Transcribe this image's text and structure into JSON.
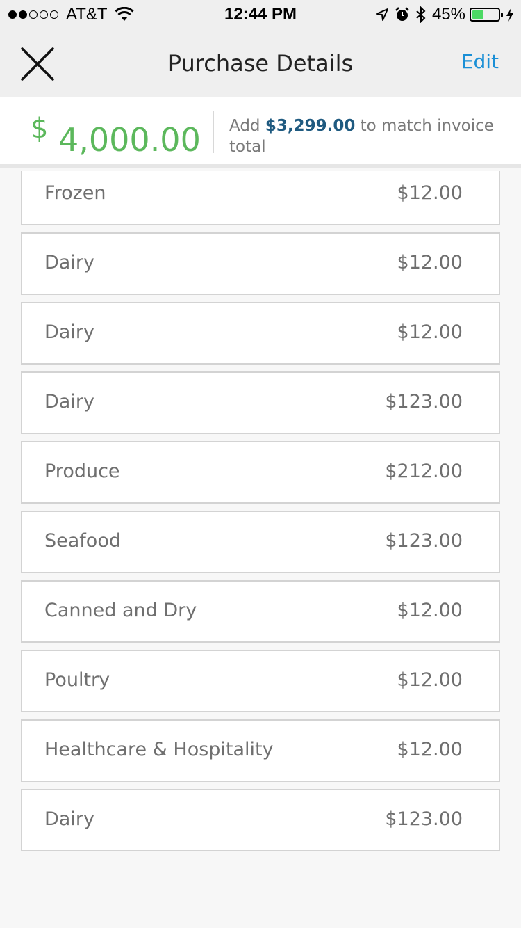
{
  "status_bar": {
    "carrier": "AT&T",
    "time": "12:44 PM",
    "battery_percent": "45%",
    "battery_level": 0.45
  },
  "nav": {
    "title": "Purchase Details",
    "edit_label": "Edit",
    "close_icon": "close-icon"
  },
  "summary": {
    "currency_symbol": "$",
    "total": "4,000.00",
    "message_prefix": "Add ",
    "match_amount": "$3,299.00",
    "message_suffix": " to match invoice total"
  },
  "items": [
    {
      "name": "Frozen",
      "price": "$12.00"
    },
    {
      "name": "Dairy",
      "price": "$12.00"
    },
    {
      "name": "Dairy",
      "price": "$12.00"
    },
    {
      "name": "Dairy",
      "price": "$123.00"
    },
    {
      "name": "Produce",
      "price": "$212.00"
    },
    {
      "name": "Seafood",
      "price": "$123.00"
    },
    {
      "name": "Canned and Dry",
      "price": "$12.00"
    },
    {
      "name": "Poultry",
      "price": "$12.00"
    },
    {
      "name": "Healthcare & Hospitality",
      "price": "$12.00"
    },
    {
      "name": "Dairy",
      "price": "$123.00"
    }
  ],
  "colors": {
    "accent_green": "#5cb85c",
    "link_blue": "#1a8fd6",
    "match_blue": "#1f5a80"
  }
}
